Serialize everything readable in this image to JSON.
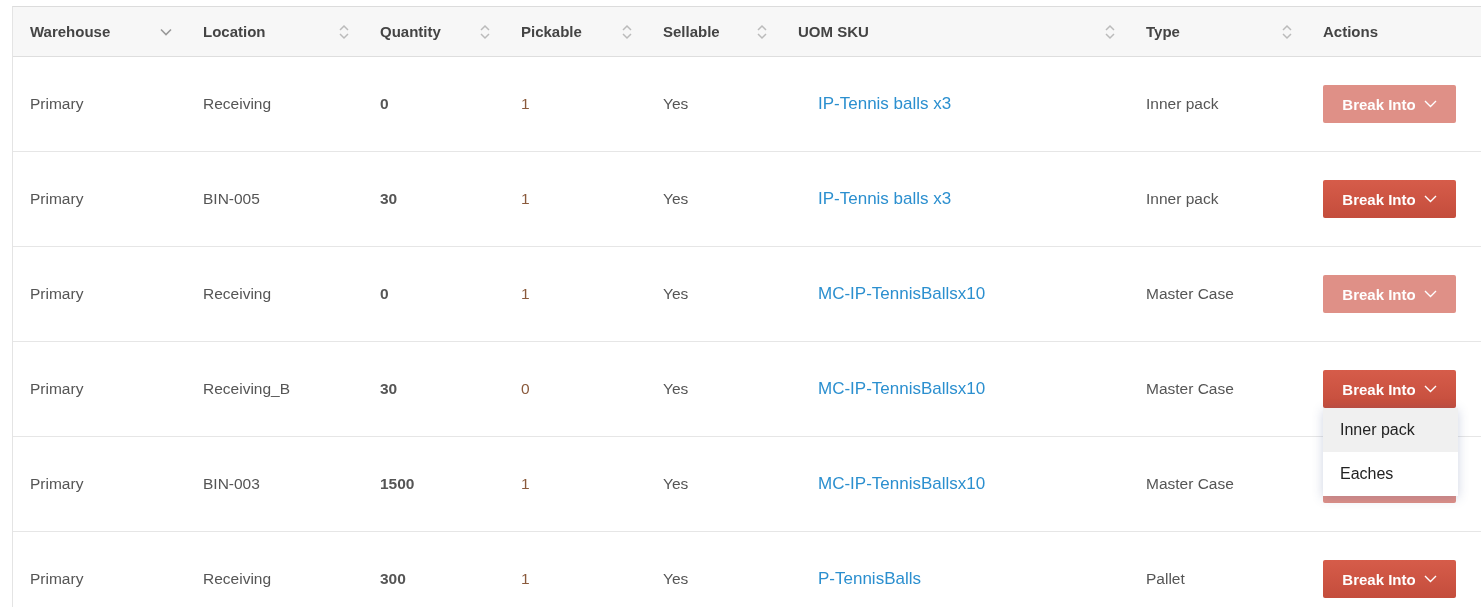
{
  "table": {
    "columns": [
      {
        "label": "Warehouse",
        "sortable": true,
        "sorted": true
      },
      {
        "label": "Location",
        "sortable": true,
        "sorted": false
      },
      {
        "label": "Quantity",
        "sortable": true,
        "sorted": false
      },
      {
        "label": "Pickable",
        "sortable": true,
        "sorted": false
      },
      {
        "label": "Sellable",
        "sortable": true,
        "sorted": false
      },
      {
        "label": "UOM SKU",
        "sortable": true,
        "sorted": false
      },
      {
        "label": "Type",
        "sortable": true,
        "sorted": false
      },
      {
        "label": "Actions",
        "sortable": false
      }
    ],
    "rows": [
      {
        "warehouse": "Primary",
        "location": "Receiving",
        "quantity": "0",
        "pickable": "1",
        "sellable": "Yes",
        "uom_sku": "IP-Tennis balls x3",
        "type": "Inner pack",
        "action": {
          "label": "Break Into",
          "disabled": true
        }
      },
      {
        "warehouse": "Primary",
        "location": "BIN-005",
        "quantity": "30",
        "pickable": "1",
        "sellable": "Yes",
        "uom_sku": "IP-Tennis balls x3",
        "type": "Inner pack",
        "action": {
          "label": "Break Into",
          "disabled": false
        }
      },
      {
        "warehouse": "Primary",
        "location": "Receiving",
        "quantity": "0",
        "pickable": "1",
        "sellable": "Yes",
        "uom_sku": "MC-IP-TennisBallsx10",
        "type": "Master Case",
        "action": {
          "label": "Break Into",
          "disabled": true
        }
      },
      {
        "warehouse": "Primary",
        "location": "Receiving_B",
        "quantity": "30",
        "pickable": "0",
        "sellable": "Yes",
        "uom_sku": "MC-IP-TennisBallsx10",
        "type": "Master Case",
        "action": {
          "label": "Break Into",
          "disabled": false,
          "menu": [
            {
              "label": "Inner pack",
              "selected": true
            },
            {
              "label": "Eaches",
              "selected": false
            }
          ]
        }
      },
      {
        "warehouse": "Primary",
        "location": "BIN-003",
        "quantity": "1500",
        "pickable": "1",
        "sellable": "Yes",
        "uom_sku": "MC-IP-TennisBallsx10",
        "type": "Master Case",
        "action": {
          "disabled": true
        }
      },
      {
        "warehouse": "Primary",
        "location": "Receiving",
        "quantity": "300",
        "pickable": "1",
        "sellable": "Yes",
        "uom_sku": "P-TennisBalls",
        "type": "Pallet",
        "action": {
          "label": "Break Into",
          "disabled": false
        }
      }
    ]
  }
}
